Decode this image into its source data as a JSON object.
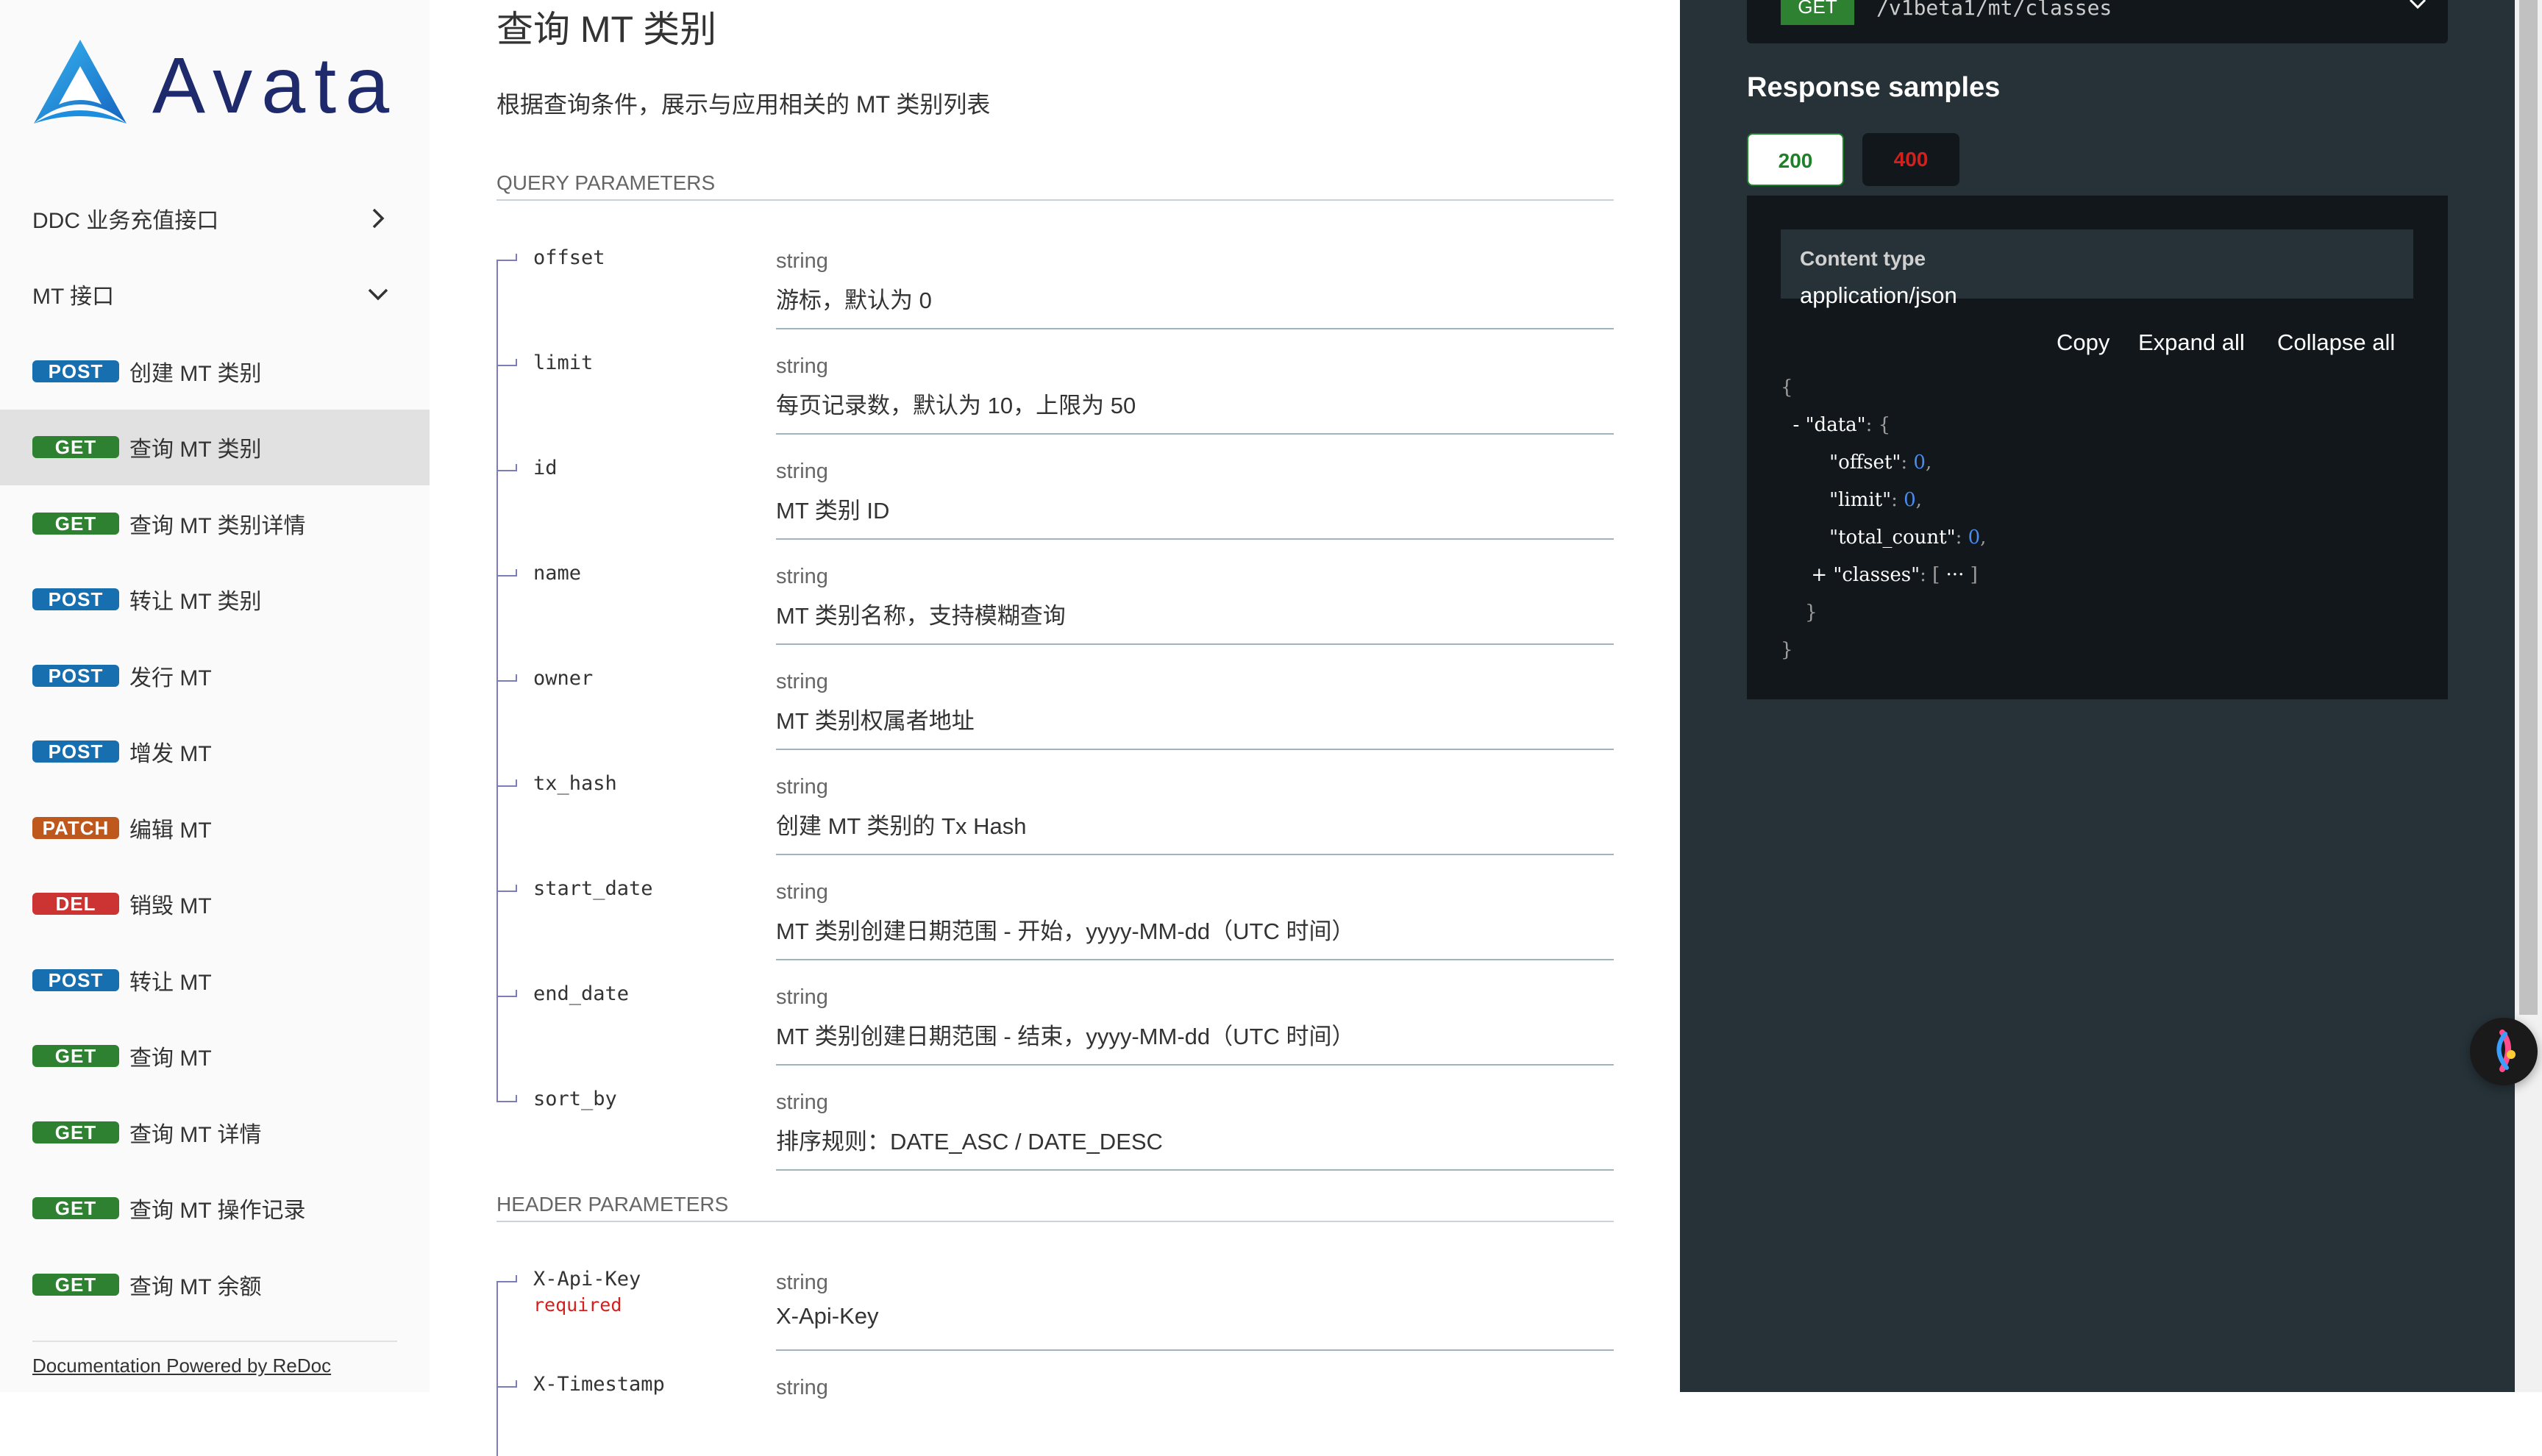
{
  "brand": {
    "name": "Avata"
  },
  "sidebar": {
    "groups": [
      {
        "label": "DDC 业务充值接口",
        "state": "collapsed"
      },
      {
        "label": "MT 接口",
        "state": "expanded"
      }
    ],
    "items": [
      {
        "method": "POST",
        "label": "创建 MT 类别",
        "active": false
      },
      {
        "method": "GET",
        "label": "查询 MT 类别",
        "active": true
      },
      {
        "method": "GET",
        "label": "查询 MT 类别详情",
        "active": false
      },
      {
        "method": "POST",
        "label": "转让 MT 类别",
        "active": false
      },
      {
        "method": "POST",
        "label": "发行 MT",
        "active": false
      },
      {
        "method": "POST",
        "label": "增发 MT",
        "active": false
      },
      {
        "method": "PATCH",
        "label": "编辑 MT",
        "active": false
      },
      {
        "method": "DEL",
        "label": "销毁 MT",
        "active": false
      },
      {
        "method": "POST",
        "label": "转让 MT",
        "active": false
      },
      {
        "method": "GET",
        "label": "查询 MT",
        "active": false
      },
      {
        "method": "GET",
        "label": "查询 MT 详情",
        "active": false
      },
      {
        "method": "GET",
        "label": "查询 MT 操作记录",
        "active": false
      },
      {
        "method": "GET",
        "label": "查询 MT 余额",
        "active": false
      }
    ],
    "footer": "Documentation Powered by ReDoc"
  },
  "main": {
    "title": "查询 MT 类别",
    "description": "根据查询条件，展示与应用相关的 MT 类别列表",
    "query_section": "QUERY PARAMETERS",
    "query_params": [
      {
        "name": "offset",
        "type": "string",
        "desc": "游标，默认为 0"
      },
      {
        "name": "limit",
        "type": "string",
        "desc": "每页记录数，默认为 10，上限为 50"
      },
      {
        "name": "id",
        "type": "string",
        "desc": "MT 类别 ID"
      },
      {
        "name": "name",
        "type": "string",
        "desc": "MT 类别名称，支持模糊查询"
      },
      {
        "name": "owner",
        "type": "string",
        "desc": "MT 类别权属者地址"
      },
      {
        "name": "tx_hash",
        "type": "string",
        "desc": "创建 MT 类别的 Tx Hash"
      },
      {
        "name": "start_date",
        "type": "string",
        "desc": "MT 类别创建日期范围 - 开始，yyyy-MM-dd（UTC 时间）"
      },
      {
        "name": "end_date",
        "type": "string",
        "desc": "MT 类别创建日期范围 - 结束，yyyy-MM-dd（UTC 时间）"
      },
      {
        "name": "sort_by",
        "type": "string",
        "desc": "排序规则：DATE_ASC / DATE_DESC"
      }
    ],
    "header_section": "HEADER PARAMETERS",
    "header_params": [
      {
        "name": "X-Api-Key",
        "required": "required",
        "type": "string",
        "desc": "X-Api-Key"
      },
      {
        "name": "X-Timestamp",
        "type": "string",
        "desc": ""
      }
    ]
  },
  "right": {
    "request": {
      "method": "GET",
      "path": "/v1beta1/mt/classes"
    },
    "response_title": "Response samples",
    "tabs": [
      {
        "label": "200"
      },
      {
        "label": "400"
      }
    ],
    "content_type_label": "Content type",
    "content_type_value": "application/json",
    "controls": {
      "copy": "Copy",
      "expand": "Expand all",
      "collapse": "Collapse all"
    },
    "json": {
      "data_key": "\"data\"",
      "offset_key": "\"offset\"",
      "offset_val": "0",
      "limit_key": "\"limit\"",
      "limit_val": "0",
      "total_key": "\"total_count\"",
      "total_val": "0",
      "classes_key": "\"classes\"",
      "ellipsis": "···"
    }
  },
  "colors": {
    "post": "#186fb0",
    "get": "#2f8132",
    "patch": "#bf581d",
    "del": "#cc3333",
    "panel": "#263238",
    "code_bg": "#11171a"
  }
}
